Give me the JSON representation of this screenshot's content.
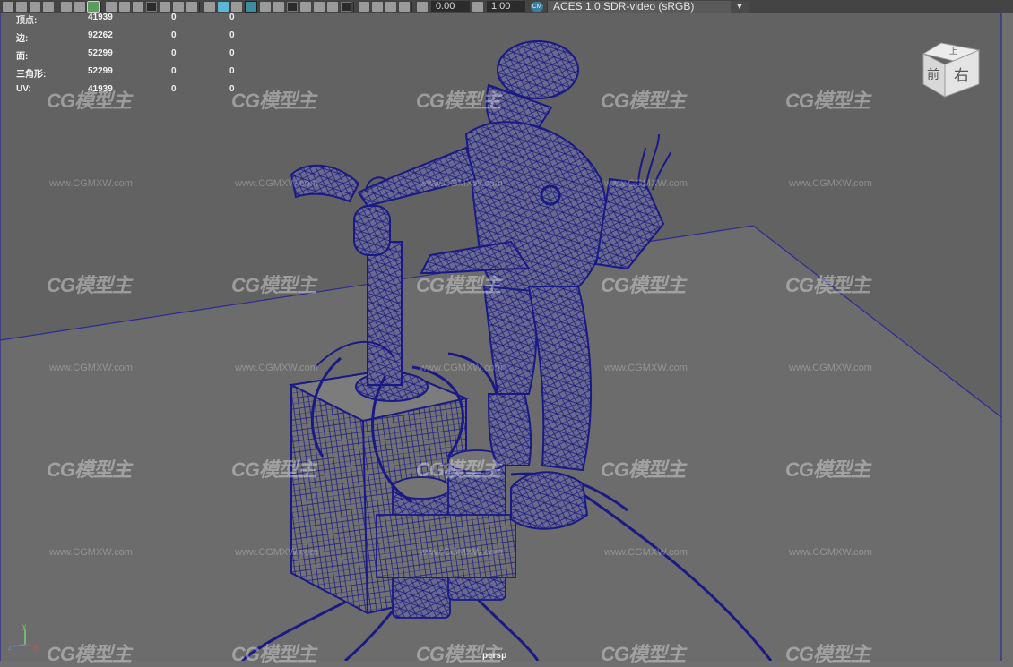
{
  "toolbar": {
    "exposure_value": "0.00",
    "gamma_value": "1.00",
    "colorspace": {
      "badge": "CM",
      "selected": "ACES 1.0 SDR-video (sRGB)"
    }
  },
  "hud": {
    "rows": [
      {
        "label": "顶点:",
        "v1": "41939",
        "v2": "0",
        "v3": "0"
      },
      {
        "label": "边:",
        "v1": "92262",
        "v2": "0",
        "v3": "0"
      },
      {
        "label": "面:",
        "v1": "52299",
        "v2": "0",
        "v3": "0"
      },
      {
        "label": "三角形:",
        "v1": "52299",
        "v2": "0",
        "v3": "0"
      },
      {
        "label": "UV:",
        "v1": "41939",
        "v2": "0",
        "v3": "0"
      }
    ]
  },
  "viewport": {
    "camera_label": "persp",
    "view_cube": {
      "front": "前",
      "right": "右",
      "top": "上"
    },
    "axis": {
      "x": "x",
      "y": "y",
      "z": "z"
    },
    "wireframe_color": "#1a1a86",
    "background_color": "#6f6f6f"
  },
  "watermark": {
    "logo": "CG模型主",
    "url": "www.CGMXW.com"
  }
}
